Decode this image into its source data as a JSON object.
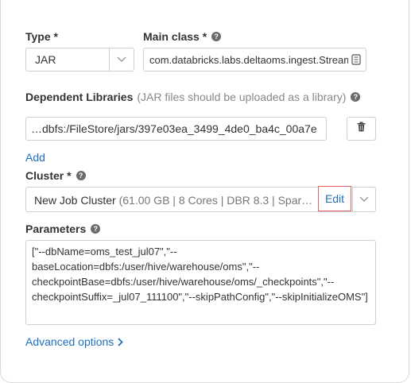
{
  "type_field": {
    "label": "Type *",
    "value": "JAR"
  },
  "main_class": {
    "label": "Main class *",
    "value": "com.databricks.labs.deltaoms.ingest.StreamPopulateOMS"
  },
  "dependent_libraries": {
    "label": "Dependent Libraries",
    "hint": "(JAR files should be uploaded as a library)",
    "path": "…dbfs:/FileStore/jars/397e03ea_3499_4de0_ba4c_00a7e",
    "add_label": "Add"
  },
  "cluster": {
    "label": "Cluster *",
    "name": "New Job Cluster",
    "details": "(61.00 GB | 8 Cores | DBR 8.3 | Spar…",
    "edit_label": "Edit"
  },
  "parameters": {
    "label": "Parameters",
    "value": "[\"--dbName=oms_test_jul07\",\"--baseLocation=dbfs:/user/hive/warehouse/oms\",\"--checkpointBase=dbfs:/user/hive/warehouse/oms/_checkpoints\",\"--checkpointSuffix=_jul07_111100\",\"--skipPathConfig\",\"--skipInitializeOMS\"]"
  },
  "advanced": {
    "label": "Advanced options"
  },
  "colors": {
    "link": "#1f6fbd",
    "edit_highlight": "#e06666",
    "border": "#cfcfcf"
  }
}
